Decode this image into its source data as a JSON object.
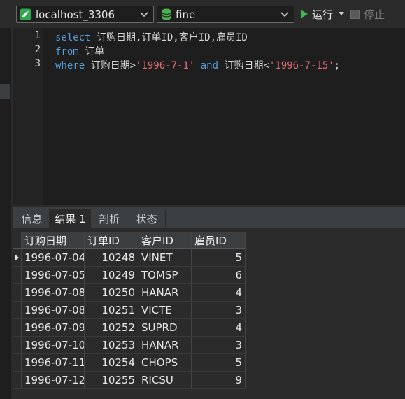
{
  "toolbar": {
    "connection": "localhost_3306",
    "database": "fine",
    "run_label": "运行",
    "stop_label": "停止"
  },
  "editor": {
    "line_numbers": [
      "1",
      "2",
      "3"
    ],
    "line1": {
      "kw": "select",
      "text": " 订购日期,订单ID,客户ID,雇员ID"
    },
    "line2": {
      "kw": "from",
      "text": " 订单"
    },
    "line3": {
      "kw": "where",
      "t1": " 订购日期>",
      "s1": "'1996-7-1'",
      "kw2": "and",
      "t2": " 订购日期<",
      "s2": "'1996-7-15'",
      "t3": ";"
    }
  },
  "tabs": [
    "信息",
    "结果 1",
    "剖析",
    "状态"
  ],
  "grid": {
    "columns": [
      "订购日期",
      "订单ID",
      "客户ID",
      "雇员ID"
    ],
    "rows": [
      [
        "1996-07-04",
        "10248",
        "VINET",
        "5"
      ],
      [
        "1996-07-05",
        "10249",
        "TOMSP",
        "6"
      ],
      [
        "1996-07-08",
        "10250",
        "HANAR",
        "4"
      ],
      [
        "1996-07-08",
        "10251",
        "VICTE",
        "3"
      ],
      [
        "1996-07-09",
        "10252",
        "SUPRD",
        "4"
      ],
      [
        "1996-07-10",
        "10253",
        "HANAR",
        "3"
      ],
      [
        "1996-07-11",
        "10254",
        "CHOPS",
        "5"
      ],
      [
        "1996-07-12",
        "10255",
        "RICSU",
        "9"
      ]
    ]
  },
  "colors": {
    "background": "#2b2b2b",
    "editor_bg": "#1e1e1e",
    "keyword": "#569cd6",
    "string": "#e06c75",
    "run_green": "#3fb950",
    "db_green": "#4caf50"
  }
}
